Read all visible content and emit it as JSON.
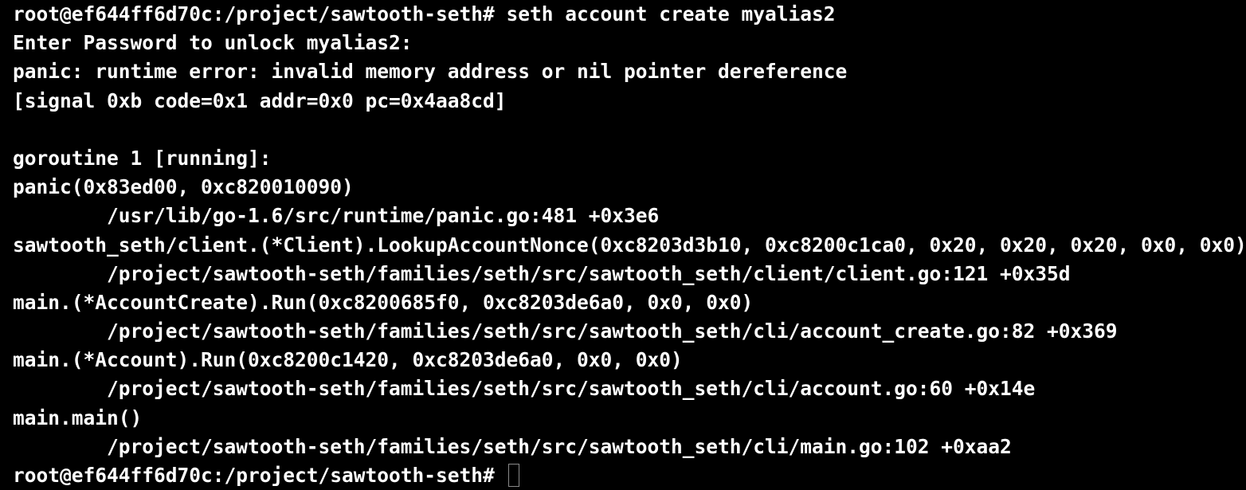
{
  "colors": {
    "background": "#000000",
    "text": "#ffffff",
    "cursor_border": "#8a8a8a"
  },
  "terminal": {
    "lines": [
      "root@ef644ff6d70c:/project/sawtooth-seth# seth account create myalias2",
      "Enter Password to unlock myalias2:",
      "panic: runtime error: invalid memory address or nil pointer dereference",
      "[signal 0xb code=0x1 addr=0x0 pc=0x4aa8cd]",
      "",
      "goroutine 1 [running]:",
      "panic(0x83ed00, 0xc820010090)",
      "        /usr/lib/go-1.6/src/runtime/panic.go:481 +0x3e6",
      "sawtooth_seth/client.(*Client).LookupAccountNonce(0xc8203d3b10, 0xc8200c1ca0, 0x20, 0x20, 0x20, 0x0, 0x0)",
      "        /project/sawtooth-seth/families/seth/src/sawtooth_seth/client/client.go:121 +0x35d",
      "main.(*AccountCreate).Run(0xc8200685f0, 0xc8203de6a0, 0x0, 0x0)",
      "        /project/sawtooth-seth/families/seth/src/sawtooth_seth/cli/account_create.go:82 +0x369",
      "main.(*Account).Run(0xc8200c1420, 0xc8203de6a0, 0x0, 0x0)",
      "        /project/sawtooth-seth/families/seth/src/sawtooth_seth/cli/account.go:60 +0x14e",
      "main.main()",
      "        /project/sawtooth-seth/families/seth/src/sawtooth_seth/cli/main.go:102 +0xaa2"
    ],
    "prompt": "root@ef644ff6d70c:/project/sawtooth-seth# "
  }
}
